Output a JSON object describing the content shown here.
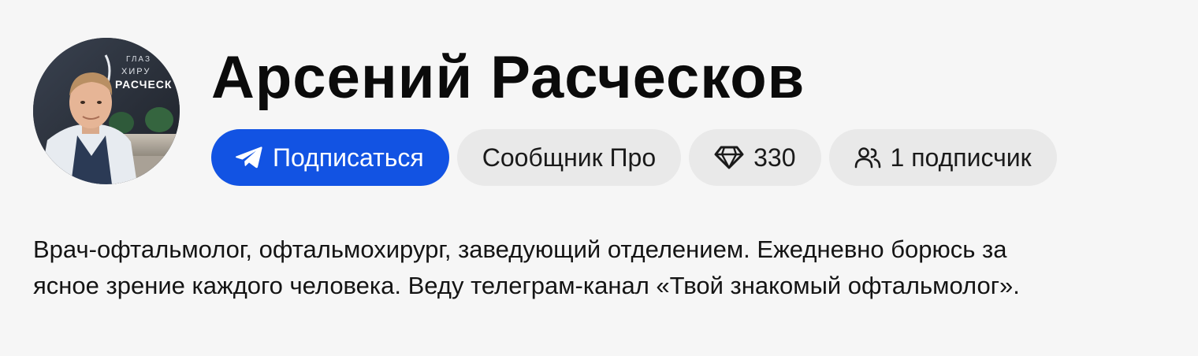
{
  "profile": {
    "name": "Арсений Расческов",
    "avatar": {
      "alt_icon": "person-photo",
      "background_sign": [
        "ГЛАЗ",
        "ХИРУ",
        "РАСЧЕСК"
      ]
    },
    "chips": {
      "subscribe": {
        "label": "Подписаться",
        "icon": "telegram-plane-icon"
      },
      "plan": {
        "label": "Сообщник Про"
      },
      "gems": {
        "value": "330",
        "icon": "diamond-icon"
      },
      "subscribers": {
        "label": "1 подписчик",
        "icon": "people-icon"
      }
    },
    "description": {
      "line1": "Врач-офтальмолог, офтальмохирург, заведующий отделением. Ежедневно борюсь за",
      "line2": "ясное зрение каждого человека. Веду телеграм-канал «Твой знакомый офтальмолог»."
    }
  },
  "colors": {
    "background": "#f6f6f6",
    "primary": "#1253e3",
    "chip_bg": "#e9e9e9",
    "text": "#111111"
  }
}
